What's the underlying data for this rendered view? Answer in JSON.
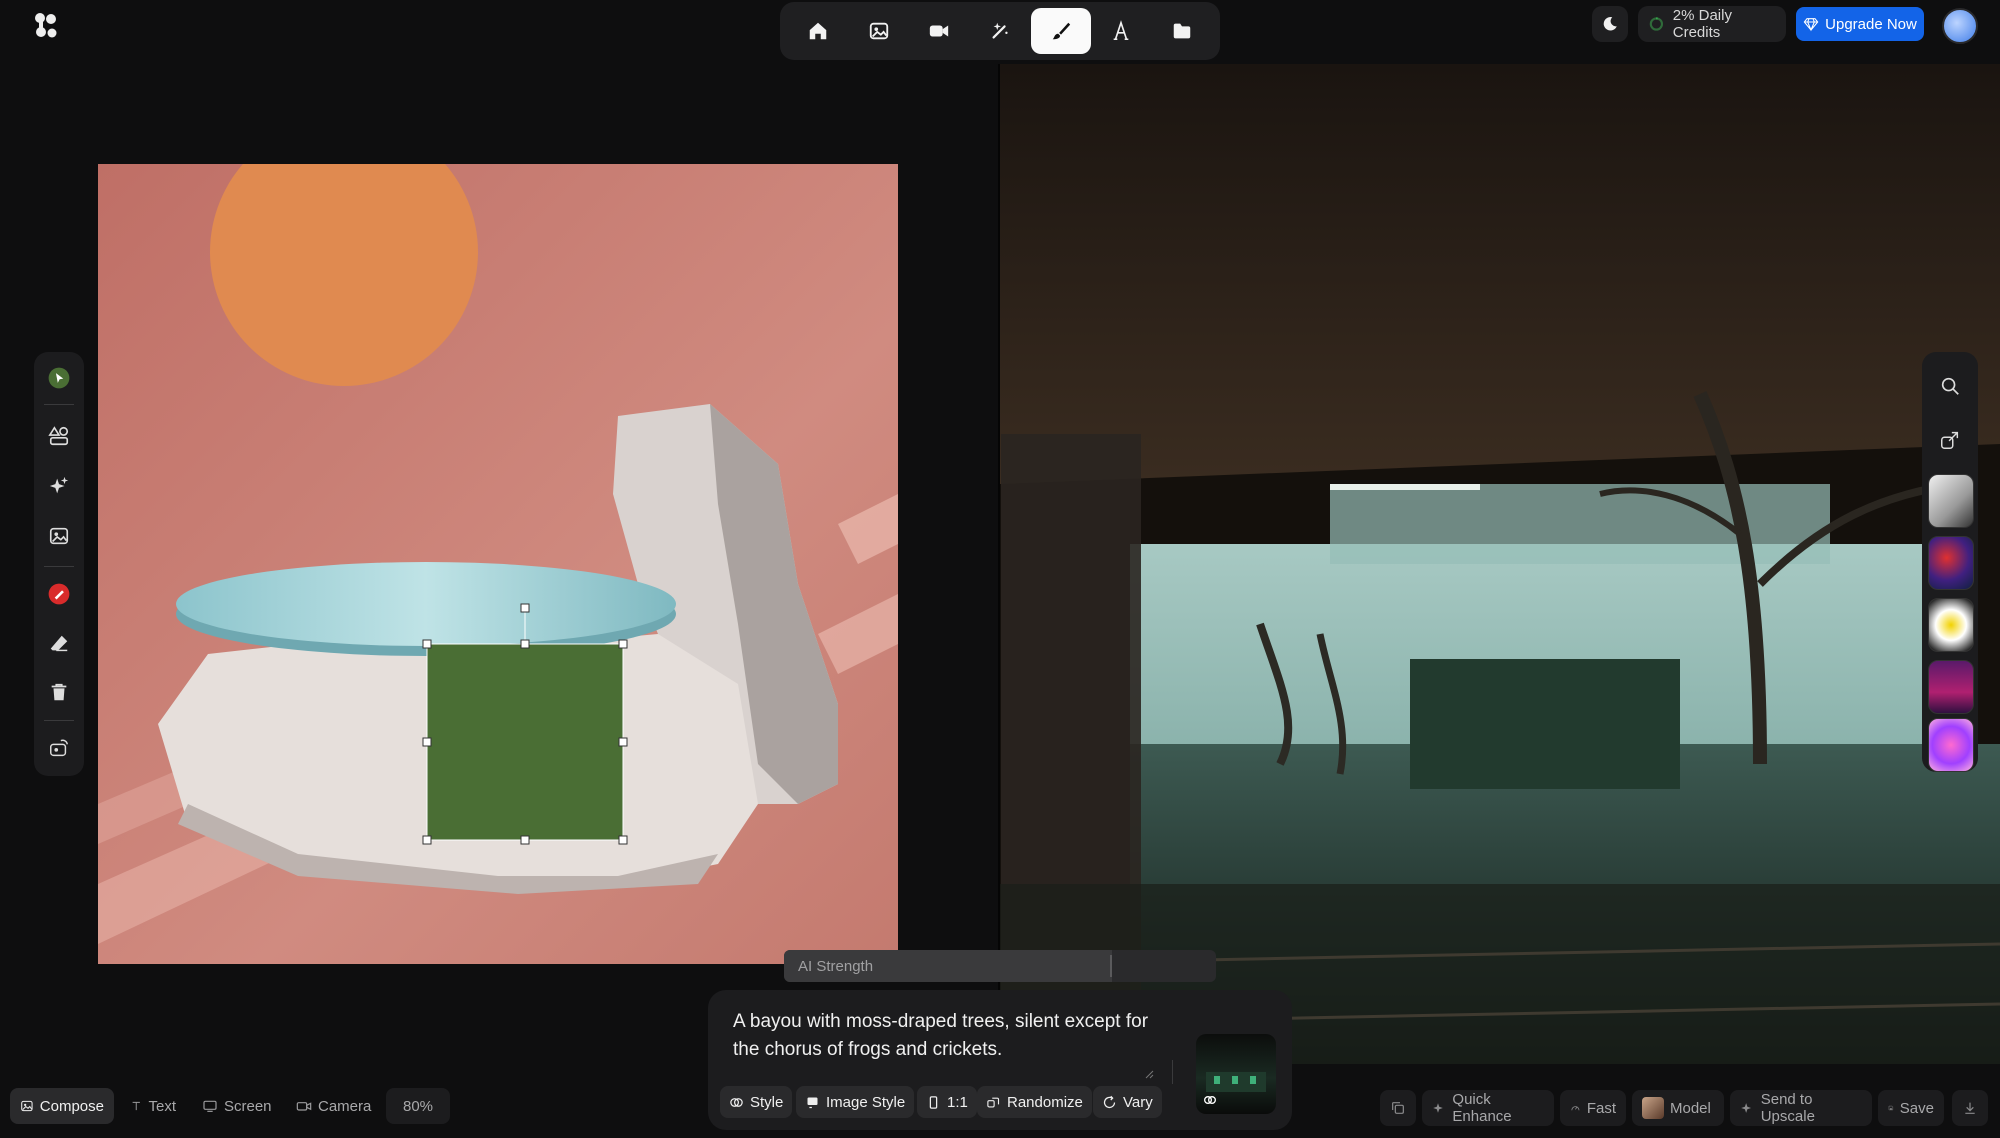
{
  "topnav": {
    "items": [
      {
        "icon": "home-icon"
      },
      {
        "icon": "image-icon"
      },
      {
        "icon": "video-icon"
      },
      {
        "icon": "magic-wand-icon"
      },
      {
        "icon": "brush-icon",
        "active": true
      },
      {
        "icon": "text-tool-icon"
      },
      {
        "icon": "folder-icon"
      }
    ]
  },
  "header": {
    "credits_label": "2% Daily Credits",
    "upgrade_label": "Upgrade Now"
  },
  "left_tools": [
    "select-icon",
    "shapes-icon",
    "sparkle-icon",
    "image-icon",
    "paint-icon",
    "eraser-icon",
    "trash-icon",
    "swap-icon"
  ],
  "right_tools": [
    "search-icon",
    "share-icon"
  ],
  "ai_strength": {
    "label": "AI Strength",
    "value": 0.76
  },
  "prompt": {
    "text": "A bayou with moss-draped trees, silent except for the chorus of frogs and crickets.",
    "chips": {
      "style": "Style",
      "image_style": "Image Style",
      "ratio": "1:1",
      "randomize": "Randomize",
      "vary": "Vary"
    }
  },
  "bottom_left": {
    "compose": "Compose",
    "text": "Text",
    "screen": "Screen",
    "camera": "Camera",
    "zoom": "80%"
  },
  "bottom_right": {
    "quick_enhance": "Quick Enhance",
    "fast": "Fast",
    "model": "Model",
    "send_to_upscale": "Send to Upscale",
    "save": "Save"
  },
  "colors": {
    "accent": "#1364e8",
    "selection_green": "#4a6e34",
    "canvas_bg": "#c8766c"
  }
}
